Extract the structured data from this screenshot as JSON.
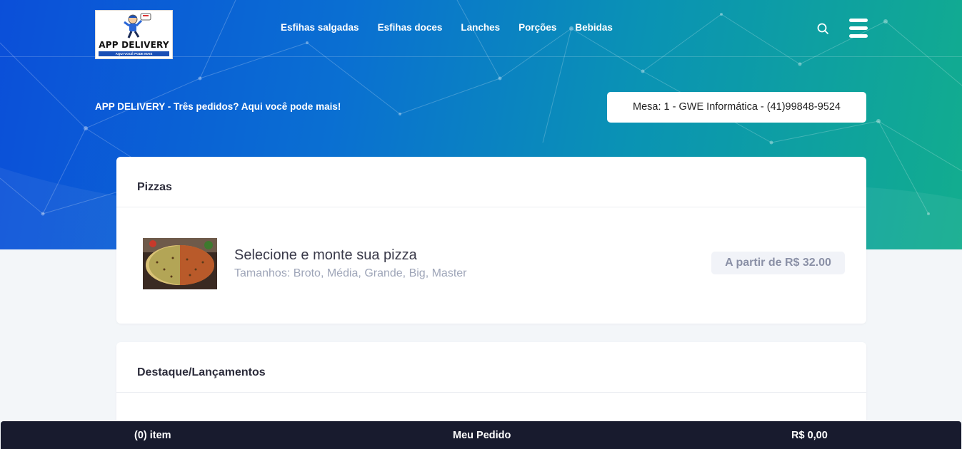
{
  "logo": {
    "title": "APP DELIVERY",
    "tagline": "AQUI VOCÊ PODE MAIS"
  },
  "nav": {
    "items": [
      "Esfihas salgadas",
      "Esfihas doces",
      "Lanches",
      "Porções",
      "Bebidas"
    ]
  },
  "header": {
    "icons": [
      "search-icon",
      "hamburger-menu-icon"
    ],
    "tagline": "APP DELIVERY - Três pedidos? Aqui você pode mais!",
    "mesa": "Mesa: 1 - GWE Informática - (41)99848-9524"
  },
  "sections": [
    {
      "title": "Pizzas",
      "product": {
        "name": "Selecione e monte sua pizza",
        "sizes": "Tamanhos: Broto, Média, Grande, Big, Master",
        "price": "A partir de R$ 32.00"
      }
    },
    {
      "title": "Destaque/Lançamentos"
    }
  ],
  "bottom_bar": {
    "items": "(0) item",
    "title": "Meu Pedido",
    "total": "R$ 0,00"
  },
  "colors": {
    "hero_start": "#0b4fd9",
    "hero_end": "#12ad8e",
    "bottom_bar": "#181b2e",
    "page_bg": "#f3f6f9"
  }
}
